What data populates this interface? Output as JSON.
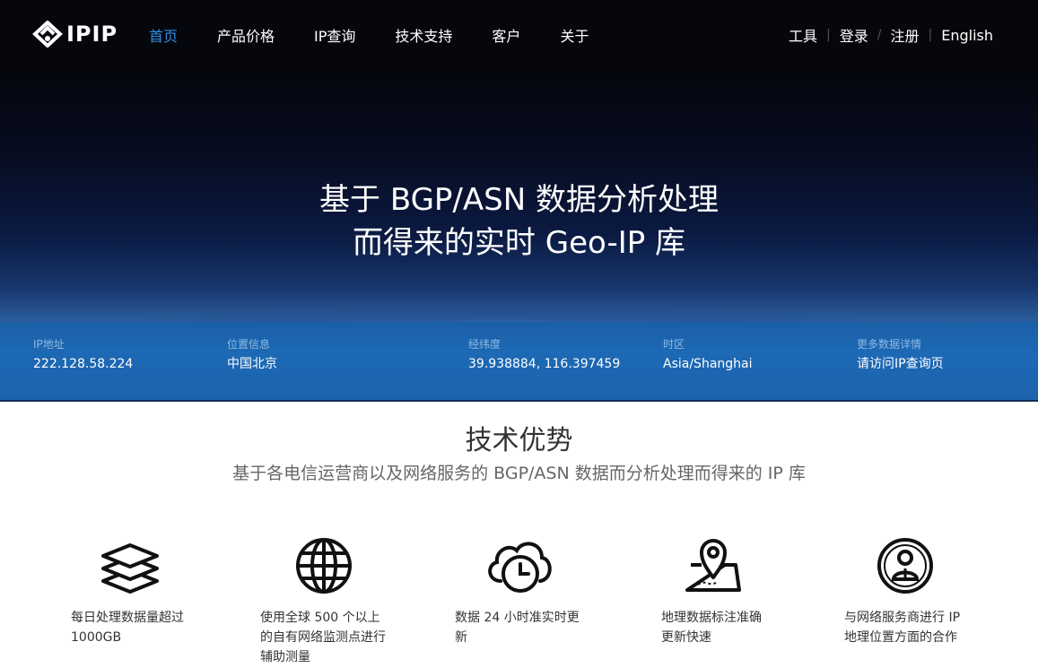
{
  "header": {
    "logo_text": "IPIP",
    "nav": [
      {
        "label": "首页",
        "active": true
      },
      {
        "label": "产品价格",
        "active": false
      },
      {
        "label": "IP查询",
        "active": false
      },
      {
        "label": "技术支持",
        "active": false
      },
      {
        "label": "客户",
        "active": false
      },
      {
        "label": "关于",
        "active": false
      }
    ],
    "user_nav": {
      "tools": "工具",
      "login": "登录",
      "register": "注册",
      "english": "English",
      "sep1": "|",
      "sep2": "/",
      "sep3": "|"
    }
  },
  "hero": {
    "title_line1": "基于 BGP/ASN 数据分析处理",
    "title_line2": "而得来的实时 Geo-IP 库"
  },
  "info": [
    {
      "label": "IP地址",
      "value": "222.128.58.224"
    },
    {
      "label": "位置信息",
      "value": "中国北京"
    },
    {
      "label": "经纬度",
      "value": "39.938884, 116.397459"
    },
    {
      "label": "时区",
      "value": "Asia/Shanghai"
    },
    {
      "label": "更多数据详情",
      "value": "请访问IP查询页"
    }
  ],
  "section": {
    "title": "技术优势",
    "subtitle": "基于各电信运营商以及网络服务的 BGP/ASN 数据而分析处理而得来的 IP 库"
  },
  "features": [
    {
      "icon": "layers-icon",
      "line1": "每日处理数据量超过",
      "line2": "1000GB",
      "line3": ""
    },
    {
      "icon": "globe-icon",
      "line1": "使用全球 500 个以上",
      "line2": "的自有网络监测点进行",
      "line3": "辅助测量"
    },
    {
      "icon": "cloud-clock-icon",
      "line1": "数据 24 小时准实时更",
      "line2": "新",
      "line3": ""
    },
    {
      "icon": "map-pin-icon",
      "line1": "地理数据标注准确",
      "line2": "更新快速",
      "line3": ""
    },
    {
      "icon": "user-badge-icon",
      "line1": "与网络服务商进行 IP",
      "line2": "地理位置方面的合作",
      "line3": ""
    }
  ],
  "colors": {
    "accent": "#2d8fe6",
    "header_bg": "#05070c",
    "info_bar": "#1d69b5"
  }
}
